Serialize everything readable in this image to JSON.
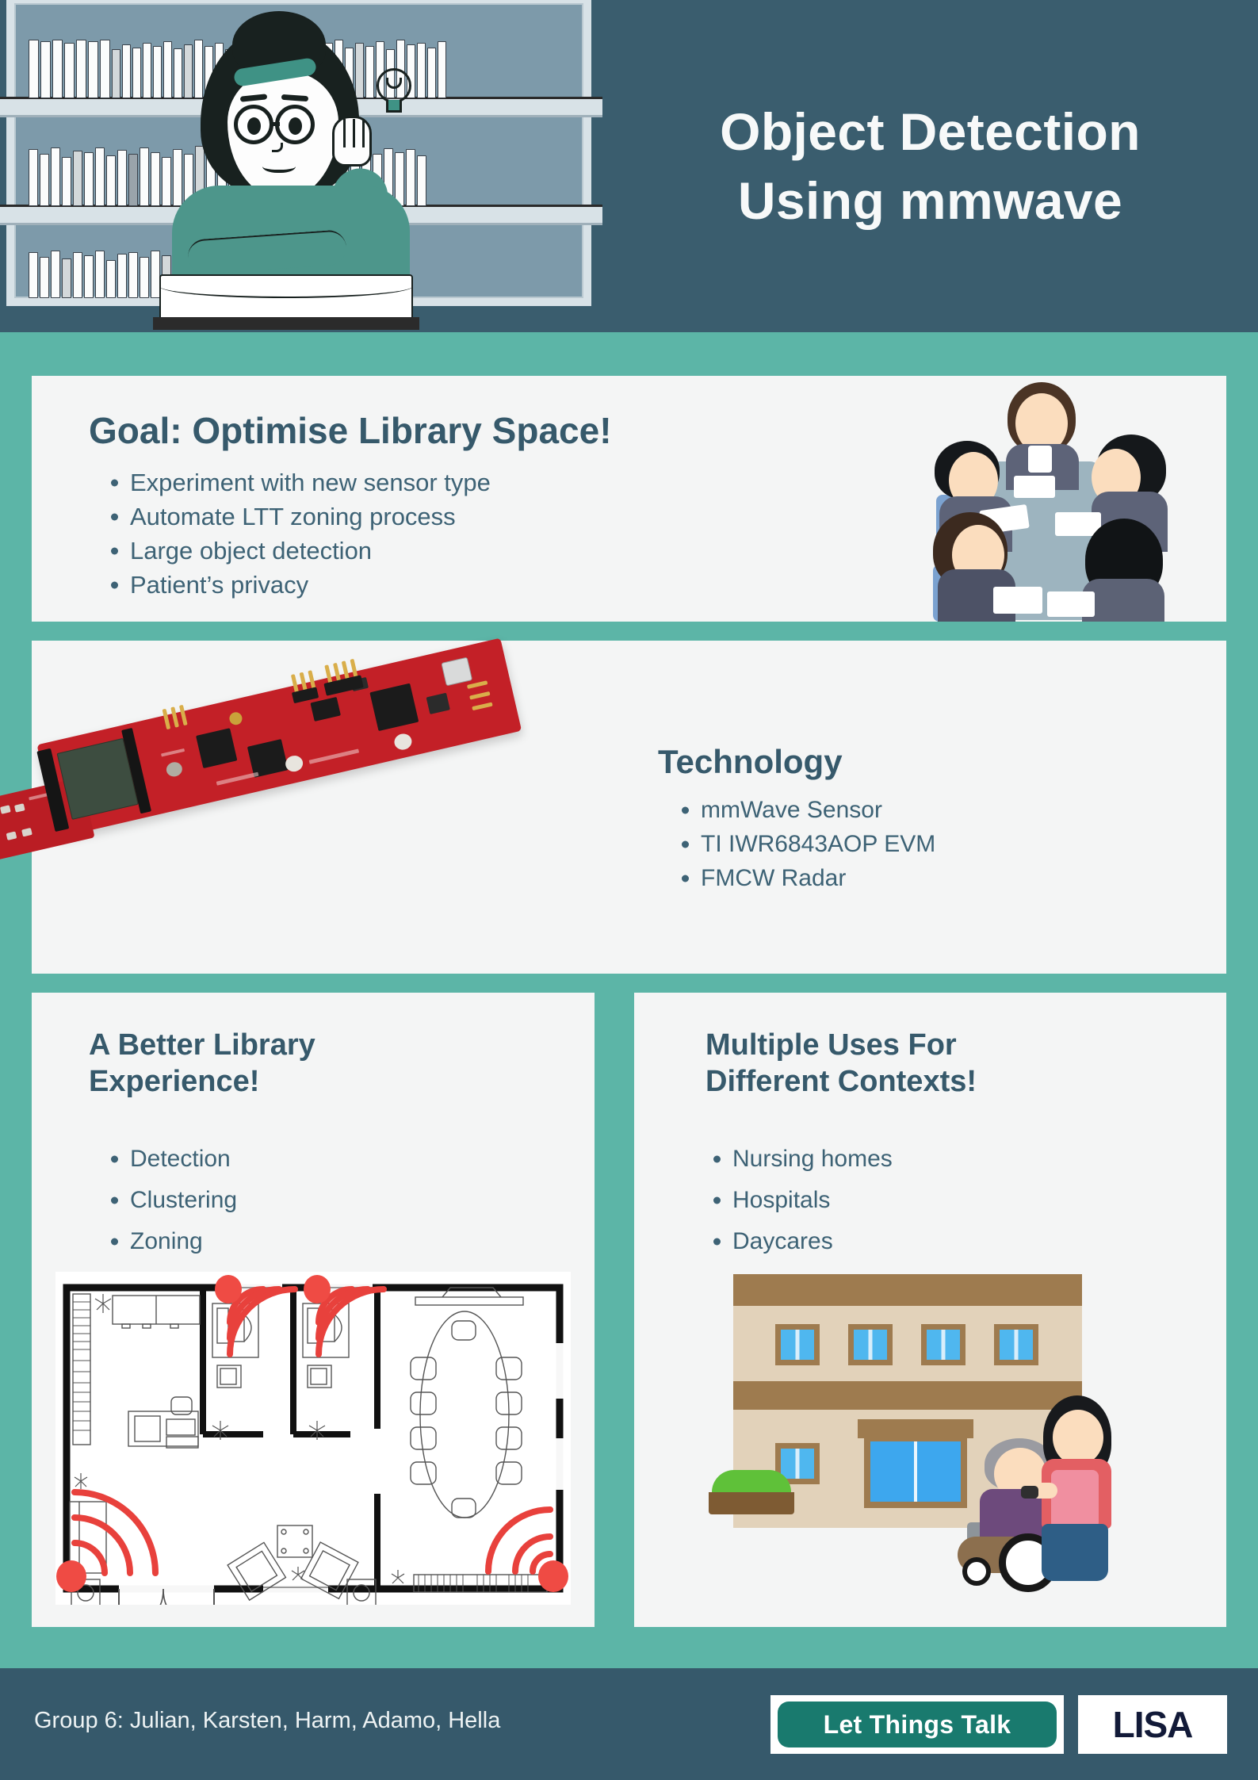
{
  "colors": {
    "header_bg": "#3a5d6e",
    "page_bg": "#5cb5a7",
    "panel_bg": "#f4f5f5",
    "heading": "#36596b",
    "body_text": "#3d6275",
    "footer_bg": "#36596b",
    "accent_red": "#e8413c",
    "pcb_red": "#c32027",
    "ltt_green": "#197a6e"
  },
  "header": {
    "title_line1": "Object Detection",
    "title_line2": "Using mmwave",
    "illustration": "librarian-at-bookshelf-illustration"
  },
  "sections": {
    "goal": {
      "title": "Goal: Optimise Library Space!",
      "bullets": [
        "Experiment with new sensor type",
        "Automate LTT zoning process",
        "Large object detection",
        "Patient’s privacy"
      ],
      "illustration": "meeting-people-illustration"
    },
    "technology": {
      "title": "Technology",
      "bullets": [
        "mmWave Sensor",
        "TI IWR6843AOP EVM",
        "FMCW Radar"
      ],
      "illustration": "mmwave-evaluation-board-photo"
    },
    "library": {
      "title_line1": "A Better Library",
      "title_line2": "Experience!",
      "bullets": [
        "Detection",
        "Clustering",
        "Zoning"
      ],
      "illustration": "office-floorplan-with-sensor-coverage"
    },
    "uses": {
      "title_line1": "Multiple Uses For",
      "title_line2": "Different Contexts!",
      "bullets": [
        "Nursing homes",
        "Hospitals",
        "Daycares"
      ],
      "illustration": "nursing-home-building-illustration"
    }
  },
  "footer": {
    "authors": "Group 6: Julian, Karsten, Harm, Adamo, Hella",
    "logo_ltt": "Let Things Talk",
    "logo_lisa": "LISA"
  }
}
